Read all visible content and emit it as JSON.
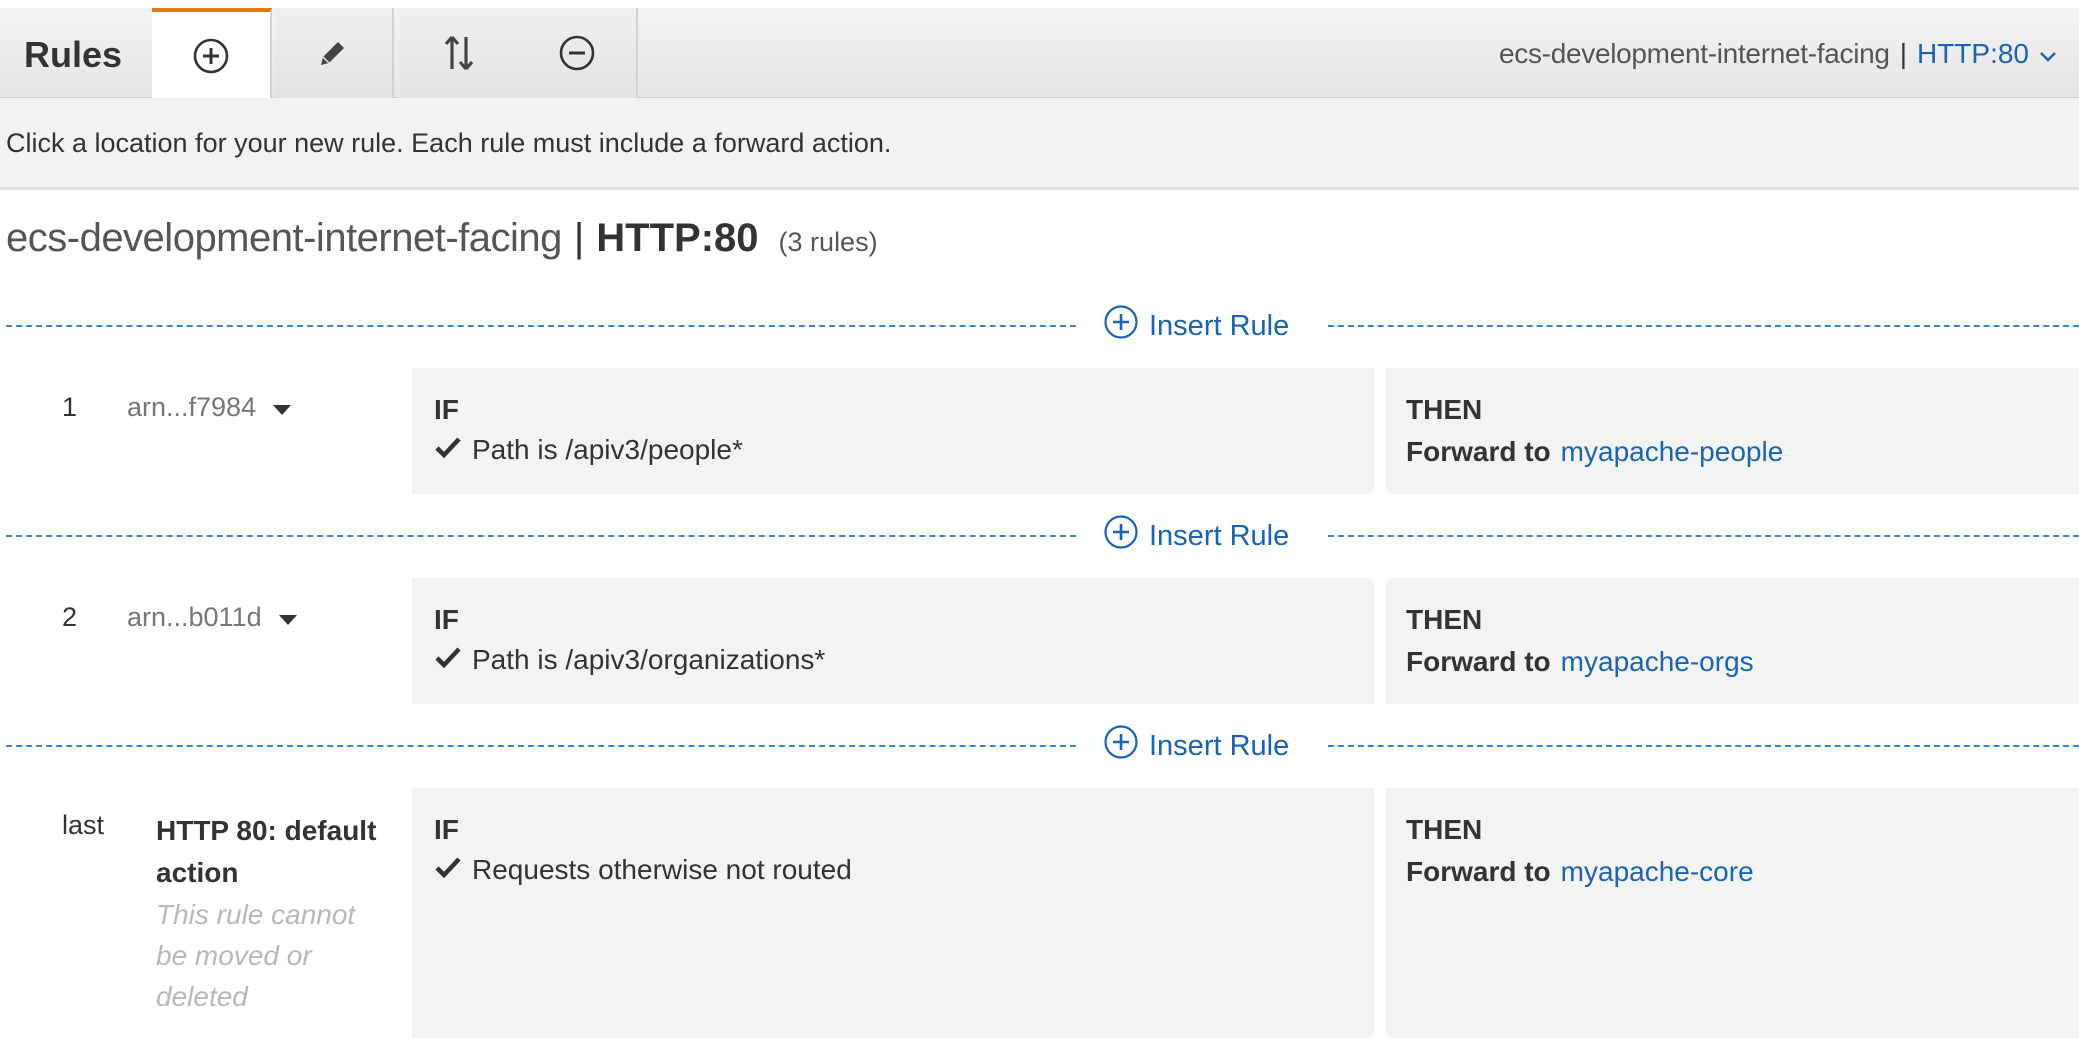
{
  "toolbar": {
    "title": "Rules",
    "buttons": [
      {
        "name": "add-rule-button",
        "icon": "plus-circle-icon",
        "active": true
      },
      {
        "name": "edit-rules-button",
        "icon": "pencil-icon",
        "active": false
      },
      {
        "name": "reorder-rules-button",
        "icon": "sort-arrows-icon",
        "active": false
      },
      {
        "name": "delete-rules-button",
        "icon": "minus-circle-icon",
        "active": false
      }
    ],
    "load_balancer": "ecs-development-internet-facing",
    "separator": "|",
    "listener": "HTTP:80"
  },
  "hint": "Click a location for your new rule. Each rule must include a forward action.",
  "heading": {
    "load_balancer": "ecs-development-internet-facing",
    "separator": "|",
    "listener": "HTTP:80",
    "rule_count": "(3 rules)"
  },
  "insert_label": "Insert Rule",
  "rules": [
    {
      "number": "1",
      "arn": "arn...f7984",
      "if_label": "IF",
      "condition": "Path is /apiv3/people*",
      "then_label": "THEN",
      "action_label": "Forward to",
      "target": "myapache-people"
    },
    {
      "number": "2",
      "arn": "arn...b011d",
      "if_label": "IF",
      "condition": "Path is /apiv3/organizations*",
      "then_label": "THEN",
      "action_label": "Forward to",
      "target": "myapache-orgs"
    },
    {
      "number": "last",
      "default_name": "HTTP 80: default action",
      "default_note": "This rule cannot be moved or deleted",
      "if_label": "IF",
      "condition": "Requests otherwise not routed",
      "then_label": "THEN",
      "action_label": "Forward to",
      "target": "myapache-core"
    }
  ],
  "colors": {
    "accent_link": "#1a63b7",
    "active_tab": "#e47911",
    "dash_line": "#3f86c8",
    "panel_bg": "#f3f3f3"
  }
}
